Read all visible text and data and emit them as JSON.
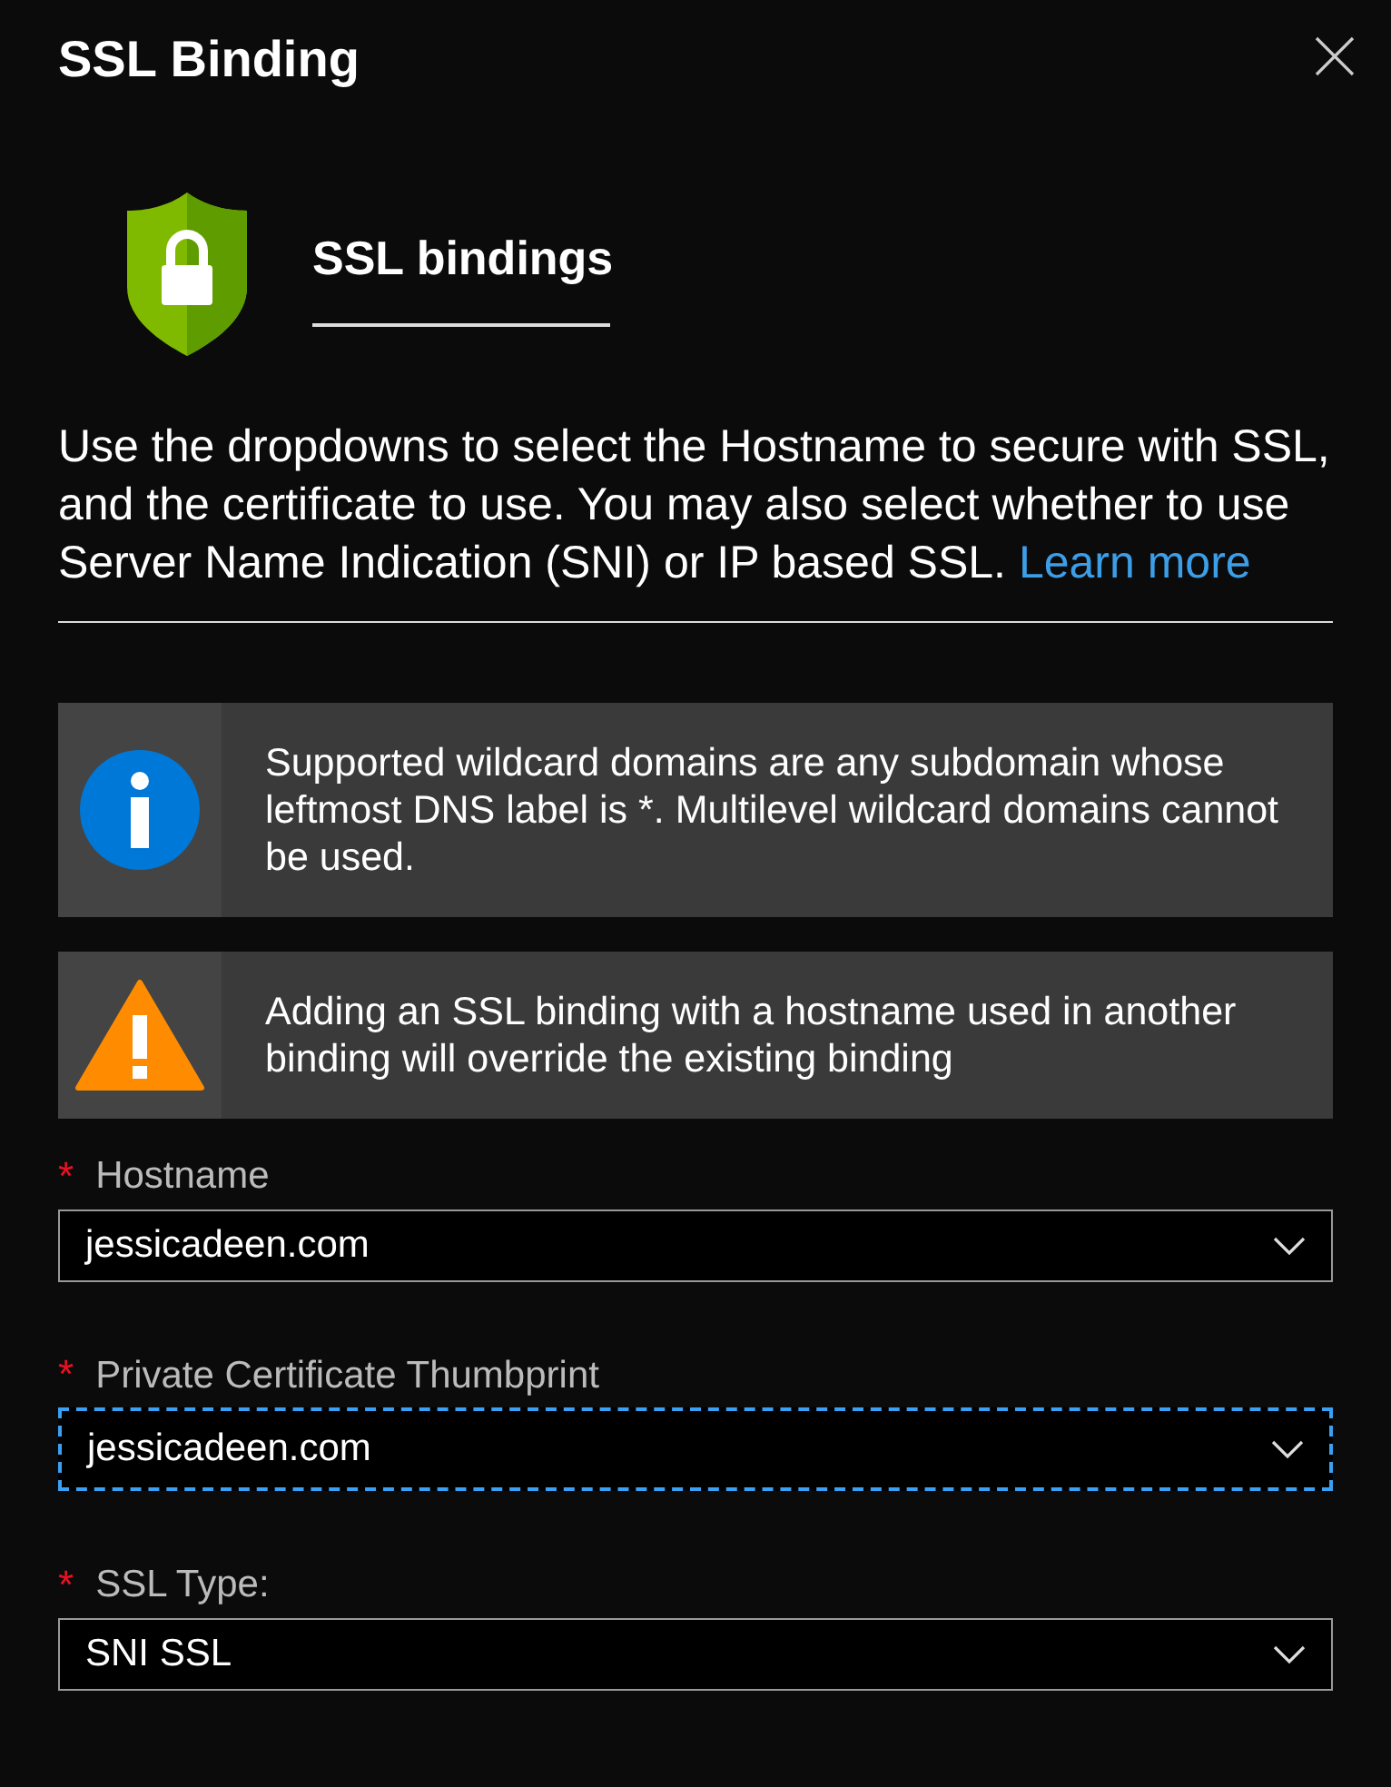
{
  "window": {
    "title": "SSL Binding"
  },
  "header": {
    "title": "SSL bindings"
  },
  "description": {
    "text": "Use the dropdowns to select the Hostname to secure with SSL, and the certificate to use. You may also select whether to use Server Name Indication (SNI) or IP based SSL.",
    "link": "Learn more"
  },
  "notices": [
    {
      "kind": "info",
      "text": "Supported wildcard domains are any subdomain whose leftmost DNS label is *. Multilevel wildcard domains cannot be used."
    },
    {
      "kind": "warning",
      "text": "Adding an SSL binding with a hostname used in another binding will override the existing binding"
    }
  ],
  "fields": [
    {
      "marker": "*",
      "label": "Hostname",
      "value": "jessicadeen.com",
      "focused": false
    },
    {
      "marker": "*",
      "label": "Private Certificate Thumbprint",
      "value": "jessicadeen.com",
      "focused": true
    },
    {
      "marker": "*",
      "label": "SSL Type:",
      "value": "SNI SSL",
      "focused": false
    }
  ]
}
